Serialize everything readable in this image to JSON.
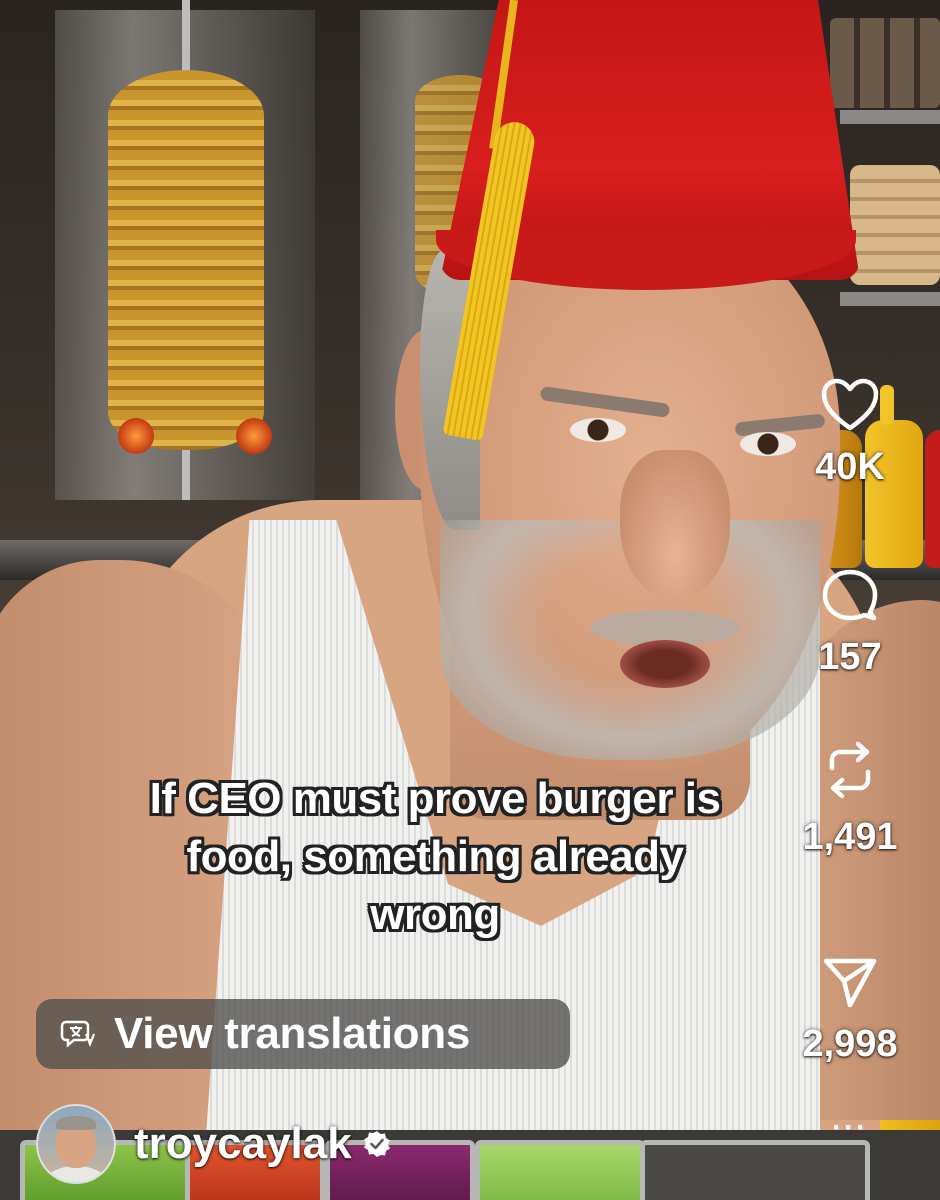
{
  "caption": {
    "lines": [
      "If CEO must prove burger is",
      "food, something already",
      "wrong"
    ]
  },
  "translate": {
    "label": "View translations",
    "icon": "translate-icon"
  },
  "actions": {
    "like": {
      "icon": "heart-icon",
      "count": "40K"
    },
    "comment": {
      "icon": "comment-bubble-icon",
      "count": "157"
    },
    "repost": {
      "icon": "repost-icon",
      "count": "1,491"
    },
    "share": {
      "icon": "send-paper-plane-icon",
      "count": "2,998"
    },
    "more": {
      "icon": "more-dots-icon",
      "label": "···"
    }
  },
  "author": {
    "username": "troycaylak",
    "verified": true,
    "avatar_icon": "avatar"
  },
  "colors": {
    "text": "#ffffff",
    "fez_red": "#d81e1e",
    "tassel_gold": "#f2c522",
    "translate_pill": "#504e4c",
    "verified_badge": "#ffffff"
  }
}
